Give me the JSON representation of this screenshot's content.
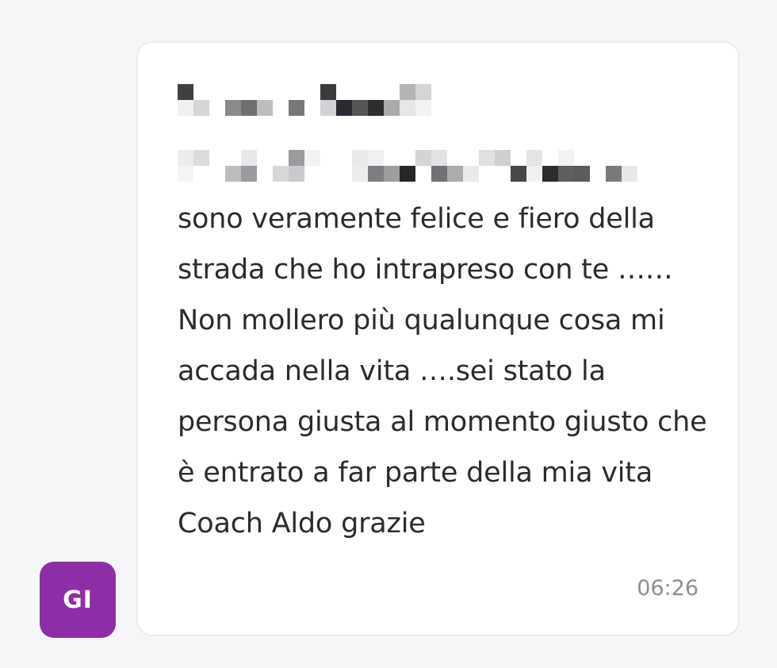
{
  "previous_message": {},
  "sender": {
    "initials": "GI",
    "avatar_color": "#8e2ea6"
  },
  "message": {
    "text": "sono veramente felice e fiero della strada che ho intrapreso con te ……Non mollero più qualunque cosa mi accada nella vita ….sei stato la persona giusta al momento giusto che è entrato a far parte della mia vita Coach Aldo grazie",
    "time": "06:26",
    "redacted_header": true
  }
}
